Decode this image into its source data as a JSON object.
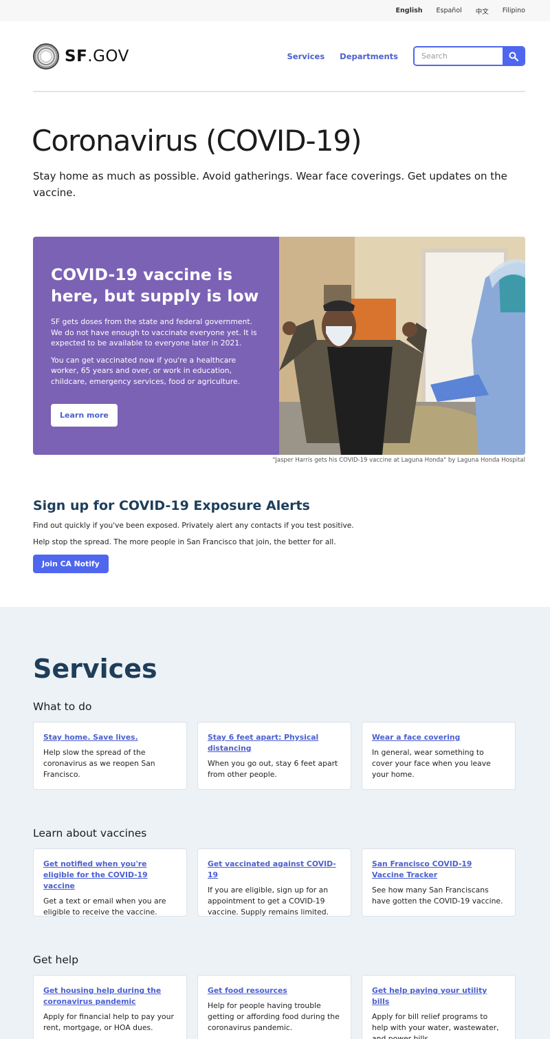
{
  "languages": [
    "English",
    "Español",
    "中文",
    "Filipino"
  ],
  "header": {
    "logo_bold": "SF",
    "logo_rest": ".GOV",
    "nav": [
      "Services",
      "Departments"
    ],
    "search_placeholder": "Search"
  },
  "page": {
    "title": "Coronavirus (COVID-19)",
    "intro": "Stay home as much as possible. Avoid gatherings. Wear face coverings. Get updates on the vaccine."
  },
  "hero": {
    "heading": "COVID-19 vaccine is here, but supply is low",
    "para1": "SF gets doses from the state and federal government. We do not have enough to vaccinate everyone yet. It is expected to be available to everyone later in 2021.",
    "para2": "You can get vaccinated now if you're a healthcare worker, 65 years and over, or work in education, childcare, emergency services, food or agriculture.",
    "button": "Learn more",
    "caption": "\"Jasper Harris gets his COVID-19 vaccine at Laguna Honda\" by Laguna Honda Hospital"
  },
  "alerts": {
    "heading": "Sign up for COVID-19 Exposure Alerts",
    "line1": "Find out quickly if you've been exposed. Privately alert any contacts if you test positive.",
    "line2": "Help stop the spread. The more people in San Francisco that join, the better for all.",
    "button": "Join CA Notify"
  },
  "services": {
    "heading": "Services",
    "groups": [
      {
        "title": "What to do",
        "cards": [
          {
            "link": "Stay home. Save lives.",
            "text": "Help slow the spread of the coronavirus as we reopen San Francisco."
          },
          {
            "link": "Stay 6 feet apart: Physical distancing",
            "text": "When you go out, stay 6 feet apart from other people."
          },
          {
            "link": "Wear a face covering",
            "text": "In general, wear something to cover your face when you leave your home."
          }
        ]
      },
      {
        "title": "Learn about vaccines",
        "cards": [
          {
            "link": "Get notified when you're eligible for the COVID-19 vaccine",
            "text": "Get a text or email when you are eligible to receive the vaccine."
          },
          {
            "link": "Get vaccinated against COVID-19",
            "text": "If you are eligible, sign up for an appointment to get a COVID-19 vaccine. Supply remains limited."
          },
          {
            "link": "San Francisco COVID-19 Vaccine Tracker",
            "text": "See how many San Franciscans have gotten the COVID-19 vaccine."
          }
        ]
      },
      {
        "title": "Get help",
        "cards": [
          {
            "link": "Get housing help during the coronavirus pandemic",
            "text": "Apply for financial help to pay your rent, mortgage, or HOA dues."
          },
          {
            "link": "Get food resources",
            "text": "Help for people having trouble getting or affording food during the coronavirus pandemic."
          },
          {
            "link": "Get help paying your utility bills",
            "text": "Apply for bill relief programs to help with your water, wastewater, and power bills."
          }
        ]
      }
    ]
  }
}
